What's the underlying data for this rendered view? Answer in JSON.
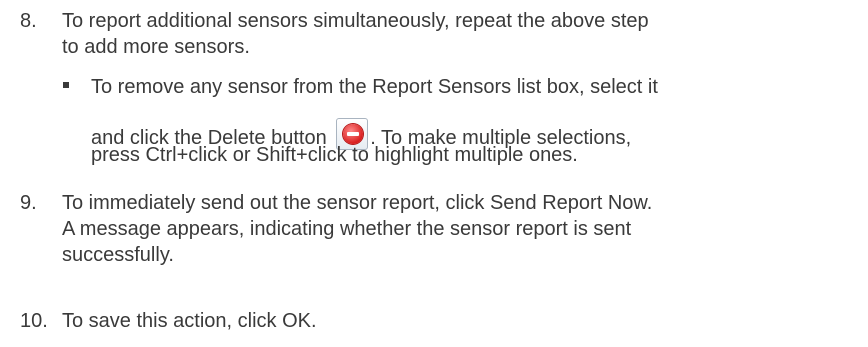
{
  "steps": [
    {
      "number": "8.",
      "lines": [
        "To report additional sensors simultaneously, repeat the above step",
        "to add more sensors."
      ],
      "bullet": {
        "line1": "To remove any sensor from the Report Sensors list box, select it",
        "line2_before": "and click the Delete button",
        "line2_after": ". To make multiple selections,",
        "line3": "press Ctrl+click or Shift+click to highlight multiple ones."
      }
    },
    {
      "number": "9.",
      "lines": [
        "To immediately send out the sensor report, click Send Report Now.",
        "A message appears, indicating whether the sensor report is sent",
        "successfully."
      ]
    },
    {
      "number": "10.",
      "lines": [
        "To save this action, click OK."
      ]
    }
  ],
  "icons": {
    "delete_button": "delete-icon"
  }
}
